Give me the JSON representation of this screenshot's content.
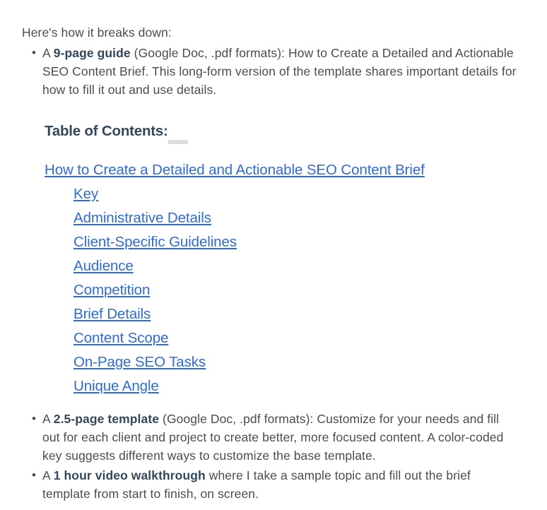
{
  "intro": {
    "text": "Here's how it breaks down:"
  },
  "top_list": [
    {
      "lead": "A ",
      "bold": "9-page guide",
      "rest": " (Google Doc, .pdf formats): How to Create a Detailed and Actionable SEO Content Brief. This long-form version of the template shares important details for how to fill it out and use details."
    }
  ],
  "toc": {
    "heading": "Table of Contents:",
    "links": [
      {
        "label": "How to Create a Detailed and Actionable SEO Content Brief",
        "indented": false
      },
      {
        "label": "Key",
        "indented": true
      },
      {
        "label": "Administrative Details",
        "indented": true
      },
      {
        "label": "Client-Specific Guidelines",
        "indented": true
      },
      {
        "label": "Audience",
        "indented": true
      },
      {
        "label": "Competition",
        "indented": true
      },
      {
        "label": "Brief Details",
        "indented": true
      },
      {
        "label": "Content Scope",
        "indented": true
      },
      {
        "label": "On-Page SEO Tasks",
        "indented": true
      },
      {
        "label": "Unique Angle",
        "indented": true
      }
    ]
  },
  "bottom_list": [
    {
      "lead": "A ",
      "bold": "2.5-page template",
      "rest": " (Google Doc, .pdf formats): Customize for your needs and fill out for each client and project to create better, more focused content. A color-coded key suggests different ways to customize the base template."
    },
    {
      "lead": "A ",
      "bold": "1 hour video walkthrough",
      "rest": " where I take a sample topic and fill out the brief template from start to finish, on screen."
    }
  ],
  "colors": {
    "body_text": "#4c4c4c",
    "heading_text": "#33475b",
    "link": "#2f6bdc",
    "highlight_mark": "#dcdde4",
    "background": "#ffffff"
  }
}
